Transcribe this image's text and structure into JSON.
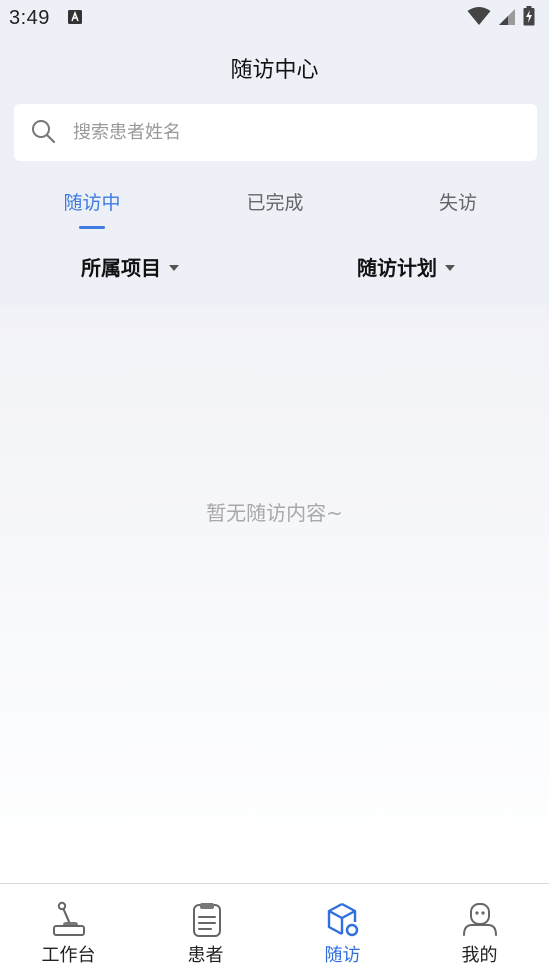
{
  "status_bar": {
    "time": "3:49",
    "icons": [
      "keyboard-a-icon",
      "wifi-icon",
      "signal-icon",
      "battery-charging-icon"
    ]
  },
  "header": {
    "title": "随访中心"
  },
  "search": {
    "placeholder": "搜索患者姓名",
    "icon": "search-icon"
  },
  "tabs": [
    {
      "label": "随访中",
      "active": true
    },
    {
      "label": "已完成",
      "active": false
    },
    {
      "label": "失访",
      "active": false
    }
  ],
  "filters": [
    {
      "label": "所属项目",
      "icon": "caret-down-icon"
    },
    {
      "label": "随访计划",
      "icon": "caret-down-icon"
    }
  ],
  "empty_state": {
    "message": "暂无随访内容~"
  },
  "bottom_nav": [
    {
      "label": "工作台",
      "icon": "joystick-icon",
      "active": false
    },
    {
      "label": "患者",
      "icon": "clipboard-icon",
      "active": false
    },
    {
      "label": "随访",
      "icon": "cube-icon",
      "active": true
    },
    {
      "label": "我的",
      "icon": "profile-icon",
      "active": false
    }
  ],
  "colors": {
    "accent": "#3f7be0",
    "background": "#edf0f7",
    "inactive_text": "#666666",
    "placeholder": "#9a9a9a"
  }
}
